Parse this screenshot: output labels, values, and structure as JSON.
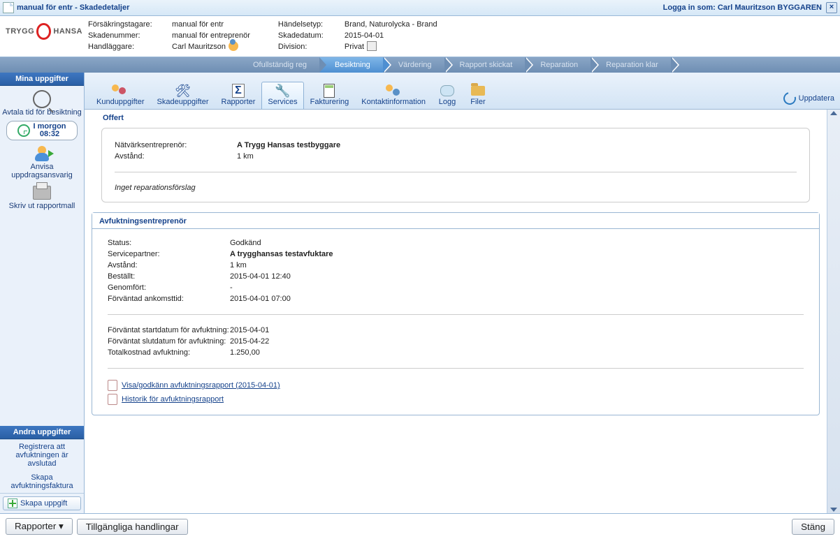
{
  "titlebar": {
    "title": "manual för entr - Skadedetaljer",
    "login_prefix": "Logga in som: ",
    "login_user": "Carl Mauritzson BYGGAREN"
  },
  "logo_text_left": "TRYGG",
  "logo_text_right": "HANSA",
  "info": {
    "col1": [
      {
        "label": "Försäkringstagare:",
        "value": "manual för entr"
      },
      {
        "label": "Skadenummer:",
        "value": "manual för entreprenör"
      },
      {
        "label": "Handläggare:",
        "value": "Carl Mauritzson",
        "person_icon": true
      }
    ],
    "col2": [
      {
        "label": "Händelsetyp:",
        "value": "Brand, Naturolycka - Brand"
      },
      {
        "label": "Skadedatum:",
        "value": "2015-04-01"
      },
      {
        "label": "Division:",
        "value": "Privat",
        "box": true
      }
    ]
  },
  "steps": [
    {
      "label": "Ofullständig reg",
      "active": false
    },
    {
      "label": "Besiktning",
      "active": true
    },
    {
      "label": "Värdering",
      "active": false
    },
    {
      "label": "Rapport skickat",
      "active": false
    },
    {
      "label": "Reparation",
      "active": false
    },
    {
      "label": "Reparation klar",
      "active": false
    }
  ],
  "sidebar": {
    "head1": "Mina uppgifter",
    "avtala": "Avtala tid för besiktning",
    "pill_line1": "I morgon",
    "pill_line2": "08:32",
    "anvisa": "Anvisa uppdragsansvarig",
    "skrivut": "Skriv ut rapportmall",
    "head2": "Andra uppgifter",
    "link1": "Registrera att avfuktningen är avslutad",
    "link2": "Skapa avfuktningsfaktura",
    "create": "Skapa uppgift"
  },
  "toolbar": {
    "items": [
      {
        "label": "Kunduppgifter",
        "icon": "users"
      },
      {
        "label": "Skadeuppgifter",
        "icon": "hammer"
      },
      {
        "label": "Rapporter",
        "icon": "sigma"
      },
      {
        "label": "Services",
        "icon": "tools",
        "active": true
      },
      {
        "label": "Fakturering",
        "icon": "calc"
      },
      {
        "label": "Kontaktinformation",
        "icon": "contact"
      },
      {
        "label": "Logg",
        "icon": "log"
      },
      {
        "label": "Filer",
        "icon": "folder"
      }
    ],
    "refresh": "Uppdatera"
  },
  "offert": {
    "legend": "Offert",
    "rows": [
      {
        "k": "Nätvärksentreprenör:",
        "v": "A Trygg Hansas testbyggare",
        "bold": true
      },
      {
        "k": "Avstånd:",
        "v": "1 km"
      }
    ],
    "note": "Inget reparationsförslag"
  },
  "avfukt": {
    "head": "Avfuktningsentreprenör",
    "group1": [
      {
        "k": "Status:",
        "v": "Godkänd"
      },
      {
        "k": "Servicepartner:",
        "v": "A trygghansas testavfuktare",
        "bold": true
      },
      {
        "k": "Avstånd:",
        "v": "1 km"
      },
      {
        "k": "Beställt:",
        "v": "2015-04-01 12:40"
      },
      {
        "k": "Genomfört:",
        "v": "-"
      },
      {
        "k": "Förväntad ankomsttid:",
        "v": "2015-04-01 07:00"
      }
    ],
    "group2": [
      {
        "k": "Förväntat startdatum för avfuktning:",
        "v": "2015-04-01"
      },
      {
        "k": "Förväntat slutdatum för avfuktning:",
        "v": "2015-04-22"
      },
      {
        "k": "Totalkostnad avfuktning:",
        "v": "1.250,00"
      }
    ],
    "links": [
      "Visa/godkänn avfuktningsrapport (2015-04-01)",
      "Historik för avfuktningsrapport"
    ]
  },
  "footer": {
    "reports": "Rapporter",
    "docs": "Tillgängliga handlingar",
    "close": "Stäng"
  }
}
